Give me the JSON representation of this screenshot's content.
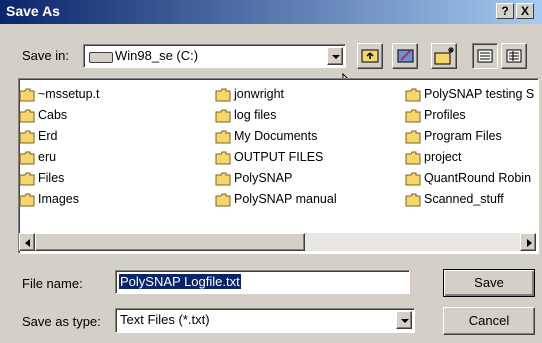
{
  "window": {
    "title": "Save As"
  },
  "title_buttons": {
    "help": "?",
    "close": "X"
  },
  "save_in": {
    "label": "Save in:",
    "value": "Win98_se (C:)"
  },
  "files": {
    "col1": [
      "~mssetup.t",
      "Cabs",
      "Erd",
      "eru",
      "Files",
      "Images"
    ],
    "col2": [
      "jonwright",
      "log files",
      "My Documents",
      "OUTPUT FILES",
      "PolySNAP",
      "PolySNAP manual"
    ],
    "col3": [
      "PolySNAP testing S",
      "Profiles",
      "Program Files",
      "project",
      "QuantRound Robin",
      "Scanned_stuff"
    ]
  },
  "file_name": {
    "label": "File name:",
    "value": "PolySNAP Logfile.txt"
  },
  "save_type": {
    "label": "Save as type:",
    "value": "Text Files (*.txt)"
  },
  "buttons": {
    "save": "Save",
    "cancel": "Cancel"
  },
  "colors": {
    "selection": "#0a246a",
    "folder": "#f5d76e",
    "face": "#d4d0c8"
  }
}
